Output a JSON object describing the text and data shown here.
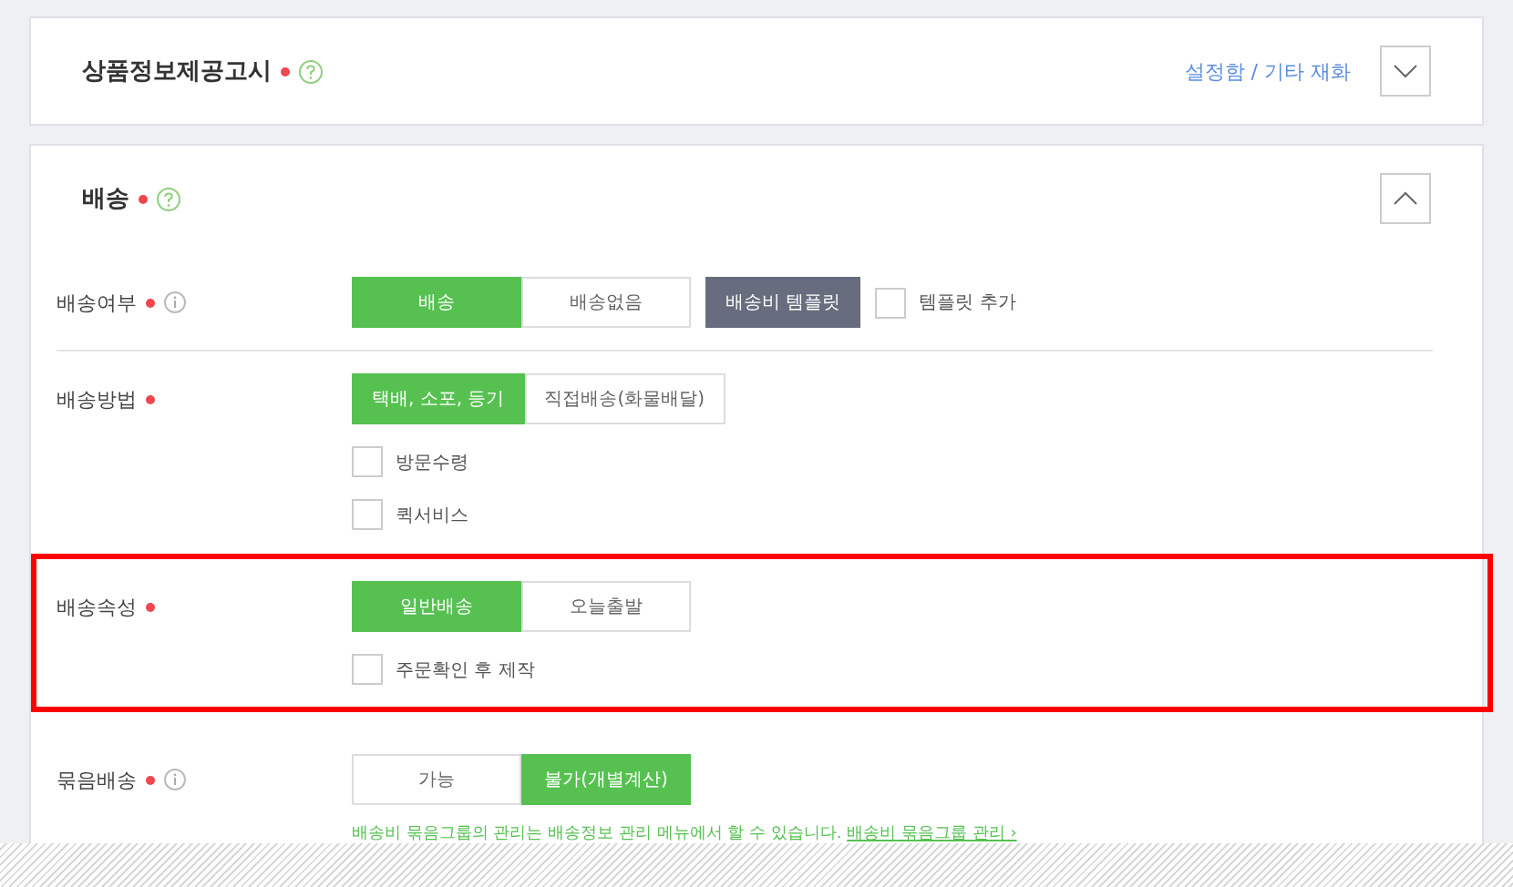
{
  "sections": [
    {
      "title": "상품정보제공고시",
      "required": true,
      "help": true,
      "link": "설정함 / 기타 재화",
      "expanded": false
    },
    {
      "title": "배송",
      "required": true,
      "help": true,
      "expanded": true,
      "fields": [
        {
          "label": "배송여부",
          "required": true,
          "info": true,
          "highlighted": false,
          "divider": true,
          "options": [
            {
              "label": "배송",
              "selected": true
            },
            {
              "label": "배송없음",
              "selected": false
            }
          ],
          "template_button": "배송비 템플릿",
          "inline_checkbox": {
            "label": "템플릿 추가",
            "checked": false
          }
        },
        {
          "label": "배송방법",
          "required": true,
          "info": false,
          "highlighted": false,
          "divider": false,
          "options": [
            {
              "label": "택배, 소포, 등기",
              "selected": true
            },
            {
              "label": "직접배송(화물배달)",
              "selected": false
            }
          ],
          "checkboxes": [
            {
              "label": "방문수령",
              "checked": false
            },
            {
              "label": "퀵서비스",
              "checked": false
            }
          ]
        },
        {
          "label": "배송속성",
          "required": true,
          "info": false,
          "highlighted": true,
          "divider": false,
          "options": [
            {
              "label": "일반배송",
              "selected": true
            },
            {
              "label": "오늘출발",
              "selected": false
            }
          ],
          "checkboxes": [
            {
              "label": "주문확인 후 제작",
              "checked": false
            }
          ]
        },
        {
          "label": "묶음배송",
          "required": true,
          "info": true,
          "highlighted": false,
          "divider": false,
          "options": [
            {
              "label": "가능",
              "selected": false
            },
            {
              "label": "불가(개별계산)",
              "selected": true
            }
          ],
          "note": "배송비 묶음그룹의 관리는 배송정보 관리 메뉴에서 할 수 있습니다.",
          "note_link": "배송비 묶음그룹 관리 ›"
        }
      ]
    }
  ]
}
